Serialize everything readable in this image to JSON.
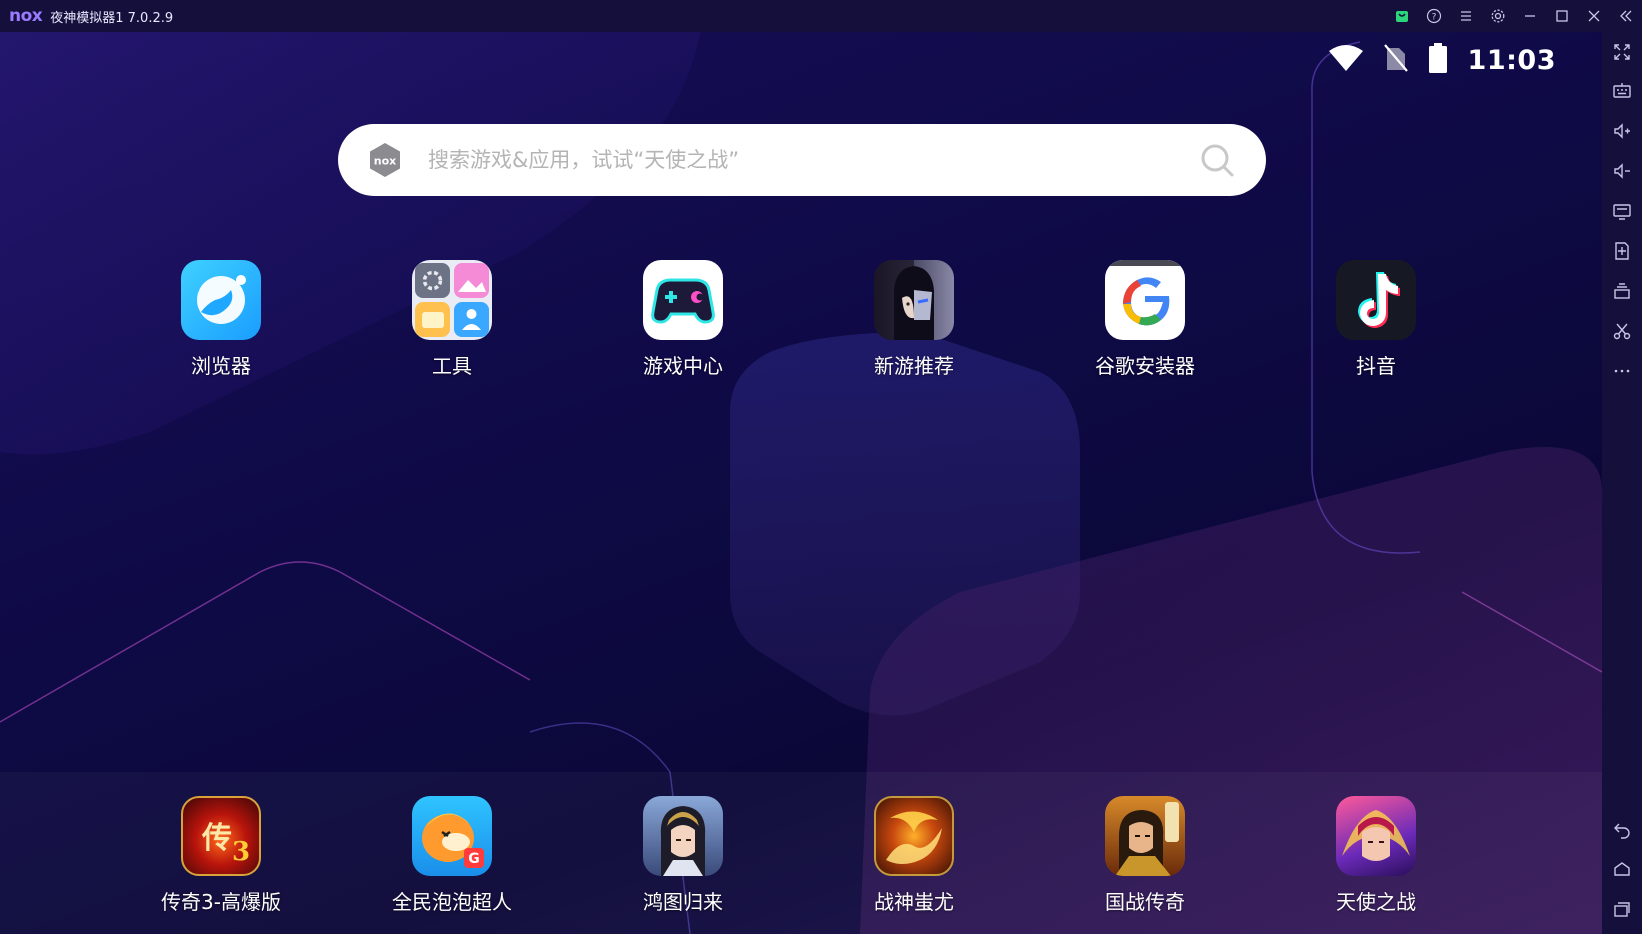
{
  "titlebar": {
    "logo": "nox",
    "title": "夜神模拟器1 7.0.2.9",
    "actions": [
      "shopping-bag-icon",
      "help-icon",
      "menu-icon",
      "settings-icon",
      "minimize-icon",
      "maximize-icon",
      "close-icon",
      "collapse-sidebar-icon"
    ]
  },
  "statusbar": {
    "icons": [
      "wifi-icon",
      "no-sim-icon",
      "battery-icon"
    ],
    "time": "11:03"
  },
  "search": {
    "placeholder": "搜索游戏&应用，试试“天使之战”"
  },
  "apps": [
    {
      "label": "浏览器",
      "icon": "browser-icon"
    },
    {
      "label": "工具",
      "icon": "tools-folder-icon"
    },
    {
      "label": "游戏中心",
      "icon": "game-center-icon"
    },
    {
      "label": "新游推荐",
      "icon": "new-games-icon"
    },
    {
      "label": "谷歌安装器",
      "icon": "google-installer-icon"
    },
    {
      "label": "抖音",
      "icon": "douyin-icon"
    }
  ],
  "dock": [
    {
      "label": "传奇3-高爆版",
      "icon": "legend3-icon"
    },
    {
      "label": "全民泡泡超人",
      "icon": "bubble-hero-icon"
    },
    {
      "label": "鸿图归来",
      "icon": "hongtu-icon"
    },
    {
      "label": "战神蚩尤",
      "icon": "chiyou-icon"
    },
    {
      "label": "国战传奇",
      "icon": "guozhan-icon"
    },
    {
      "label": "天使之战",
      "icon": "angel-war-icon"
    }
  ],
  "sidebar": {
    "top": [
      "fullscreen-icon",
      "keyboard-icon",
      "volume-up-icon",
      "volume-down-icon",
      "screen-icon",
      "add-apk-icon",
      "multi-instance-icon",
      "scissors-icon",
      "more-icon"
    ],
    "bottom": [
      "back-icon",
      "home-icon",
      "recent-apps-icon"
    ]
  },
  "colors": {
    "titlebar": "#14103b",
    "screen_bg": "#0c0838",
    "accent": "#9b7bff"
  }
}
